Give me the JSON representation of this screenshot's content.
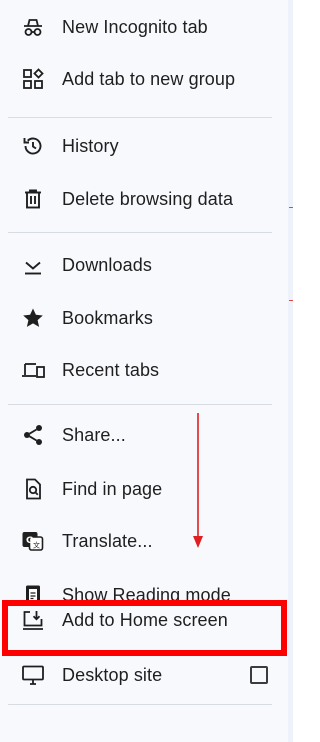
{
  "menu": {
    "items": [
      {
        "label": "New Incognito tab",
        "icon": "incognito-icon"
      },
      {
        "label": "Add tab to new group",
        "icon": "tab-group-icon"
      },
      {
        "label": "History",
        "icon": "history-icon"
      },
      {
        "label": "Delete browsing data",
        "icon": "trash-icon"
      },
      {
        "label": "Downloads",
        "icon": "download-icon"
      },
      {
        "label": "Bookmarks",
        "icon": "star-icon"
      },
      {
        "label": "Recent tabs",
        "icon": "devices-icon"
      },
      {
        "label": "Share...",
        "icon": "share-icon"
      },
      {
        "label": "Find in page",
        "icon": "find-icon"
      },
      {
        "label": "Translate...",
        "icon": "translate-icon"
      },
      {
        "label": "Show Reading mode",
        "icon": "reading-mode-icon"
      },
      {
        "label": "Add to Home screen",
        "icon": "add-to-home-icon"
      },
      {
        "label": "Desktop site",
        "icon": "desktop-icon",
        "checkbox": false
      }
    ]
  },
  "annotation": {
    "highlight_color": "#ff0000",
    "highlighted_item": "Add to Home screen"
  }
}
